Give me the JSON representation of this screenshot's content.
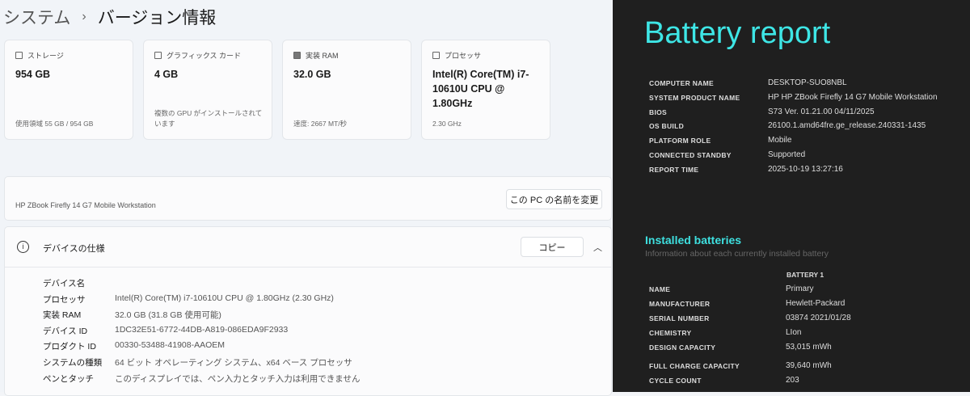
{
  "settings": {
    "breadcrumb": {
      "parent": "システム",
      "separator": "›",
      "current": "バージョン情報"
    },
    "cards": [
      {
        "icon": "storage-icon",
        "label": "ストレージ",
        "value": "954 GB",
        "sub": "使用領域 55 GB / 954 GB"
      },
      {
        "icon": "graphics-card-icon",
        "label": "グラフィックス カード",
        "value": "4 GB",
        "sub": "複数の GPU がインストールされています"
      },
      {
        "icon": "ram-icon",
        "label": "実装 RAM",
        "value": "32.0 GB",
        "sub": "速度: 2667 MT/秒"
      },
      {
        "icon": "processor-icon",
        "label": "プロセッサ",
        "value": "Intel(R) Core(TM) i7-10610U CPU @ 1.80GHz",
        "sub": "2.30 GHz"
      }
    ],
    "device_name": "HP ZBook Firefly 14 G7 Mobile Workstation",
    "rename_button": "この PC の名前を変更",
    "spec_title": "デバイスの仕様",
    "copy_button": "コピー",
    "specs": [
      {
        "k": "デバイス名",
        "v": ""
      },
      {
        "k": "プロセッサ",
        "v": "Intel(R) Core(TM) i7-10610U CPU @ 1.80GHz (2.30 GHz)"
      },
      {
        "k": "実装 RAM",
        "v": "32.0 GB (31.8 GB 使用可能)"
      },
      {
        "k": "デバイス ID",
        "v": "1DC32E51-6772-44DB-A819-086EDA9F2933"
      },
      {
        "k": "プロダクト ID",
        "v": "00330-53488-41908-AAOEM"
      },
      {
        "k": "システムの種類",
        "v": "64 ビット オペレーティング システム、x64 ベース プロセッサ"
      },
      {
        "k": "ペンとタッチ",
        "v": "このディスプレイでは、ペン入力とタッチ入力は利用できません"
      }
    ]
  },
  "report": {
    "title": "Battery report",
    "system": [
      {
        "k": "COMPUTER NAME",
        "v": "DESKTOP-SUO8NBL"
      },
      {
        "k": "SYSTEM PRODUCT NAME",
        "v": "HP HP ZBook Firefly 14 G7 Mobile Workstation"
      },
      {
        "k": "BIOS",
        "v": "S73 Ver. 01.21.00 04/11/2025"
      },
      {
        "k": "OS BUILD",
        "v": "26100.1.amd64fre.ge_release.240331-1435"
      },
      {
        "k": "PLATFORM ROLE",
        "v": "Mobile"
      },
      {
        "k": "CONNECTED STANDBY",
        "v": "Supported"
      },
      {
        "k": "REPORT TIME",
        "v": "2025-10-19  13:27:16"
      }
    ],
    "installed_title": "Installed batteries",
    "installed_sub": "Information about each currently installed battery",
    "battery_header": "BATTERY 1",
    "battery": [
      {
        "k": "NAME",
        "v": "Primary"
      },
      {
        "k": "MANUFACTURER",
        "v": "Hewlett-Packard"
      },
      {
        "k": "SERIAL NUMBER",
        "v": "03874 2021/01/28"
      },
      {
        "k": "CHEMISTRY",
        "v": "LIon"
      },
      {
        "k": "DESIGN CAPACITY",
        "v": "53,015 mWh"
      },
      {
        "k": "FULL CHARGE CAPACITY",
        "v": "39,640 mWh"
      },
      {
        "k": "CYCLE COUNT",
        "v": "203"
      }
    ]
  }
}
